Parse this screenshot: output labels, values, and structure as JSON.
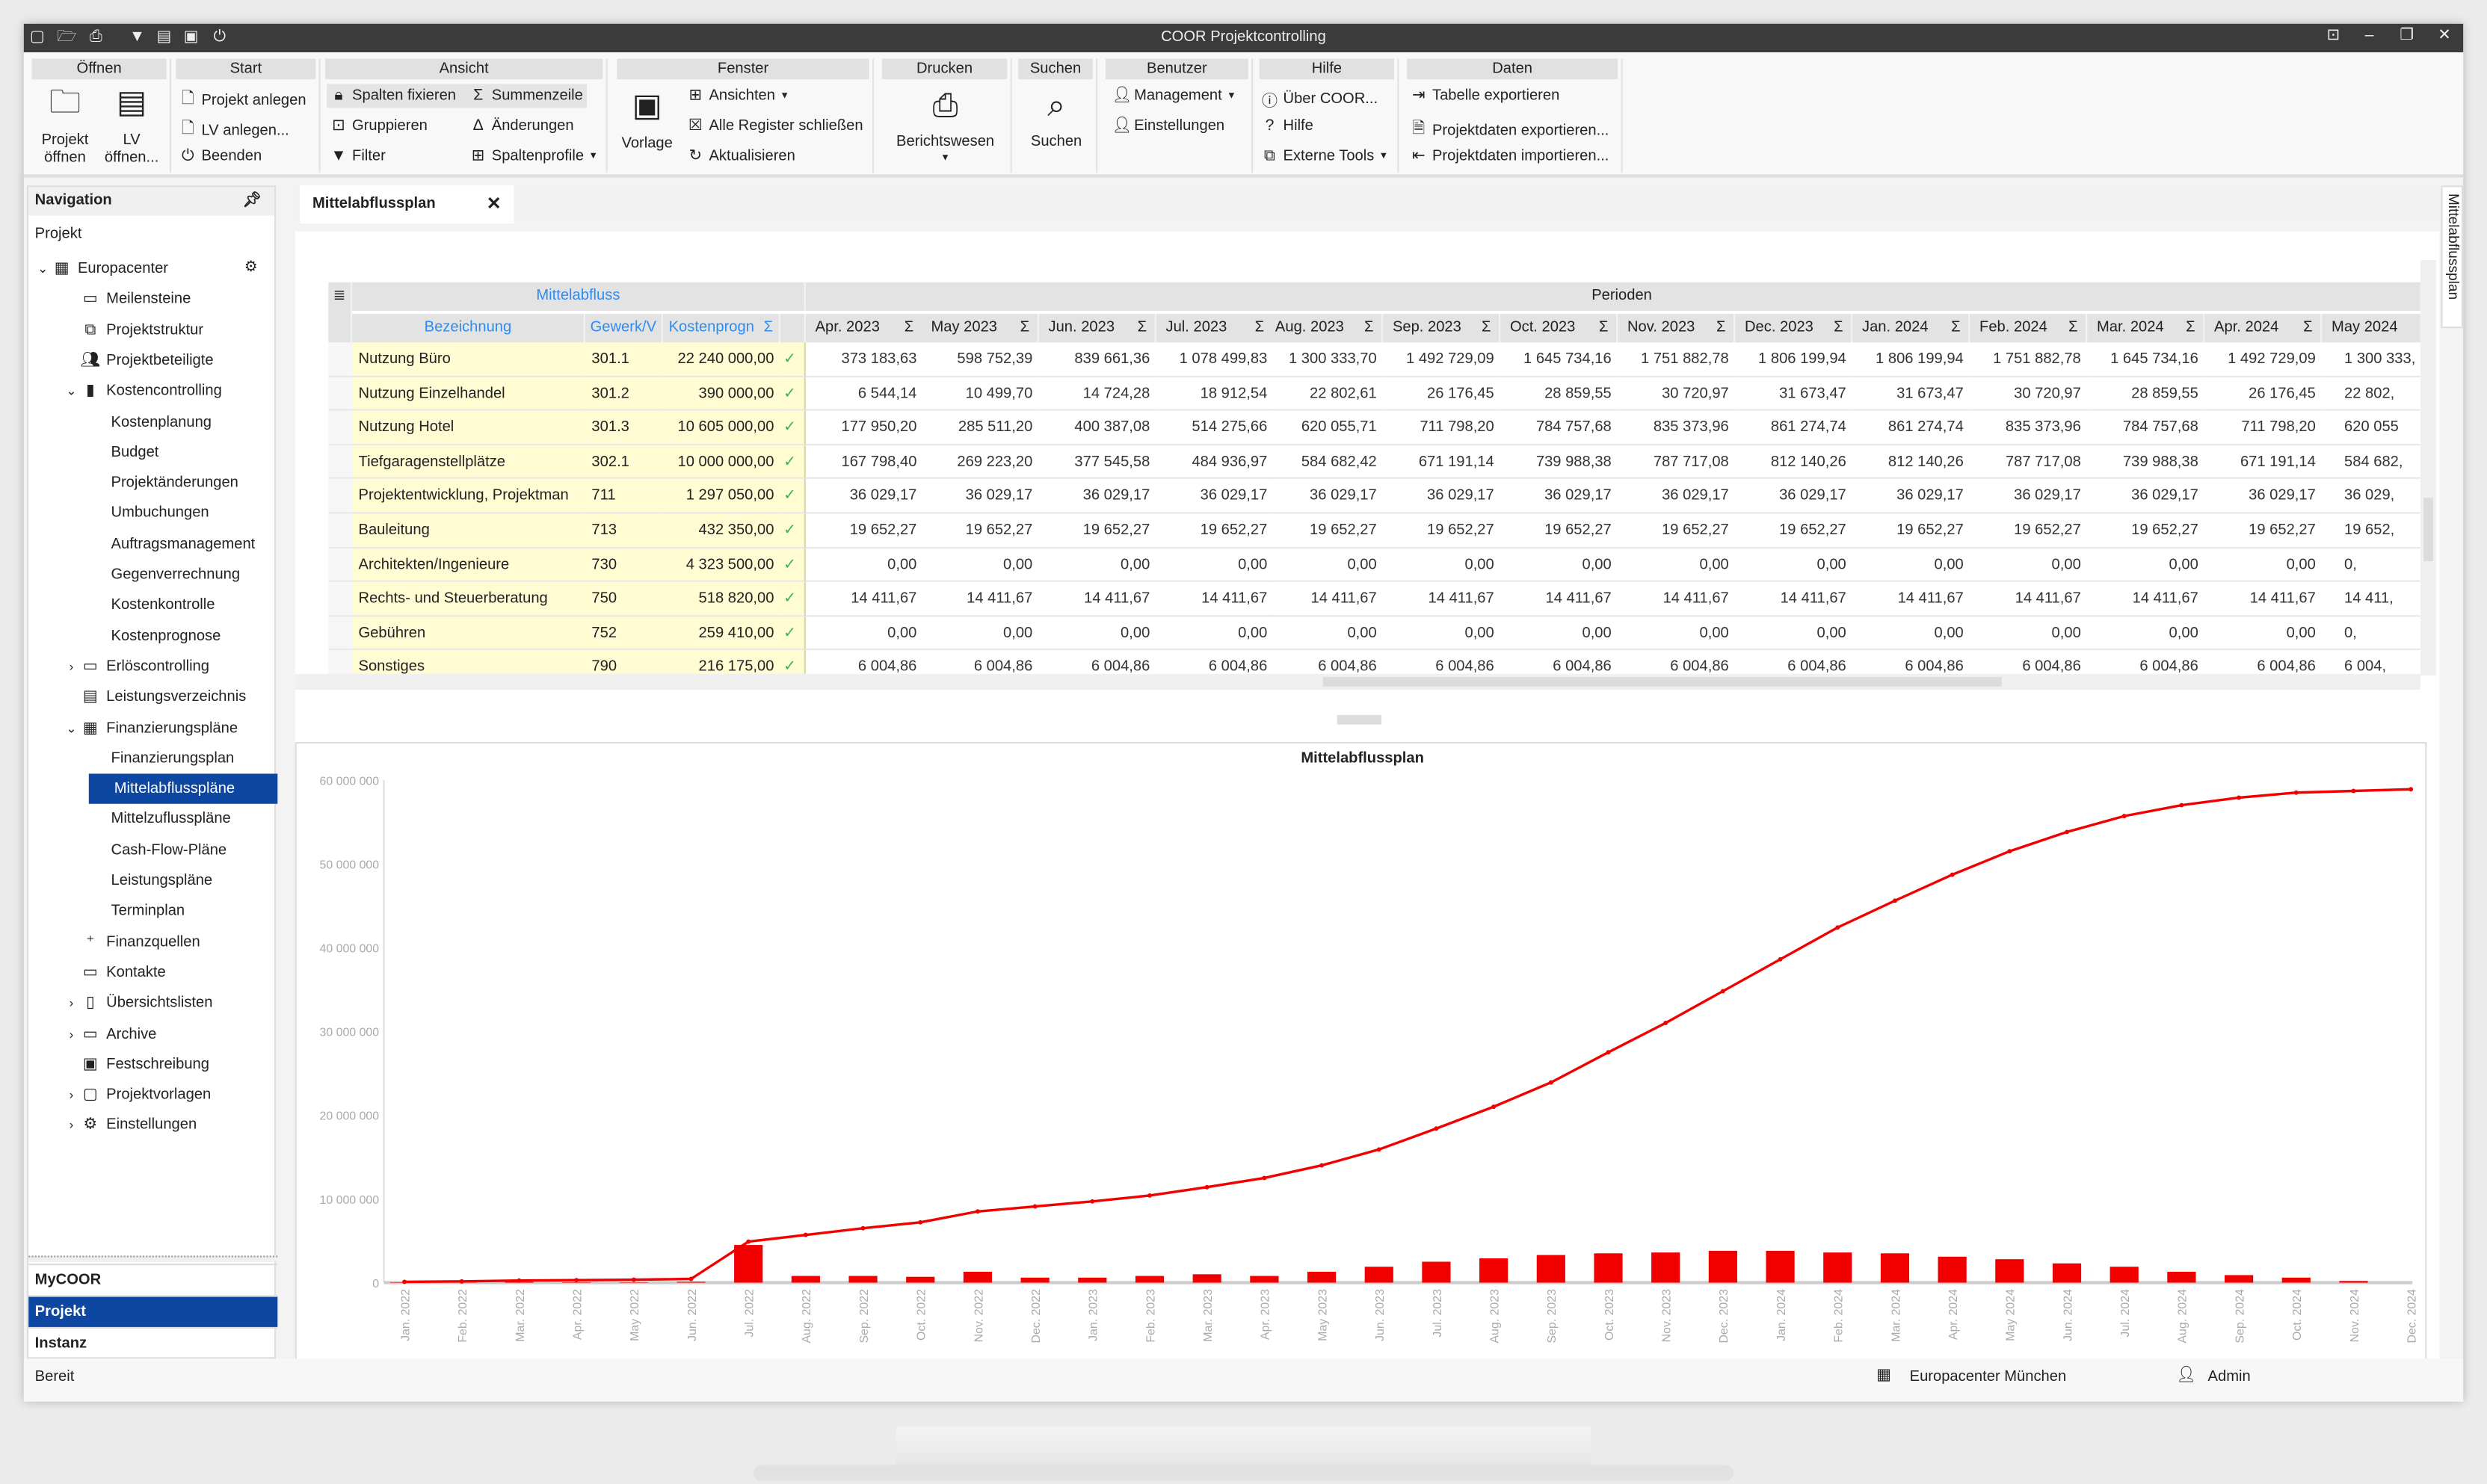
{
  "window": {
    "title": "COOR Projektcontrolling",
    "accent": "#0d47a1",
    "chart_color": "#f20000"
  },
  "quick_access": [
    "window-icon",
    "folder-open-icon",
    "print-icon",
    "filter-icon",
    "list-icon",
    "card-icon",
    "power-icon"
  ],
  "window_controls": [
    "restore-icon",
    "minimize-icon",
    "maximize-icon",
    "close-icon"
  ],
  "ribbon": {
    "oeffnen": {
      "title": "Öffnen",
      "projekt": "Projekt\nöffnen",
      "lv": "LV\nöffnen..."
    },
    "start": {
      "title": "Start",
      "projekt_anlegen": "Projekt anlegen",
      "lv_anlegen": "LV anlegen...",
      "beenden": "Beenden"
    },
    "ansicht": {
      "title": "Ansicht",
      "spalten_fixieren": "Spalten fixieren",
      "summenzeile": "Summenzeile",
      "gruppieren": "Gruppieren",
      "aenderungen": "Änderungen",
      "filter": "Filter",
      "spaltenprofile": "Spaltenprofile"
    },
    "fenster": {
      "title": "Fenster",
      "vorlage": "Vorlage",
      "ansichten": "Ansichten",
      "alle_register": "Alle Register schließen",
      "aktualisieren": "Aktualisieren"
    },
    "drucken": {
      "title": "Drucken",
      "berichtswesen": "Berichtswesen"
    },
    "suchen": {
      "title": "Suchen",
      "suchen": "Suchen"
    },
    "benutzer": {
      "title": "Benutzer",
      "management": "Management",
      "einstellungen": "Einstellungen"
    },
    "hilfe": {
      "title": "Hilfe",
      "ueber": "Über COOR...",
      "hilfe": "Hilfe",
      "externe_tools": "Externe Tools"
    },
    "daten": {
      "title": "Daten",
      "tabelle_exportieren": "Tabelle exportieren",
      "projektdaten_exportieren": "Projektdaten exportieren...",
      "projektdaten_importieren": "Projektdaten importieren..."
    }
  },
  "navigation": {
    "title": "Navigation",
    "section": "Projekt",
    "items": [
      {
        "label": "Europacenter",
        "level": 0,
        "expander": "open",
        "icon": "building-icon"
      },
      {
        "label": "Meilensteine",
        "level": 1,
        "icon": "calendar-icon"
      },
      {
        "label": "Projektstruktur",
        "level": 1,
        "icon": "structure-icon"
      },
      {
        "label": "Projektbeteiligte",
        "level": 1,
        "icon": "people-icon"
      },
      {
        "label": "Kostencontrolling",
        "level": 1,
        "expander": "open",
        "icon": "bar-chart-icon"
      },
      {
        "label": "Kostenplanung",
        "level": 2
      },
      {
        "label": "Budget",
        "level": 2
      },
      {
        "label": "Projektänderungen",
        "level": 2
      },
      {
        "label": "Umbuchungen",
        "level": 2
      },
      {
        "label": "Auftragsmanagement",
        "level": 2
      },
      {
        "label": "Gegenverrechnung",
        "level": 2
      },
      {
        "label": "Kostenkontrolle",
        "level": 2
      },
      {
        "label": "Kostenprognose",
        "level": 2
      },
      {
        "label": "Erlöscontrolling",
        "level": 1,
        "expander": "closed",
        "icon": "money-icon"
      },
      {
        "label": "Leistungsverzeichnis",
        "level": 1,
        "icon": "list-icon"
      },
      {
        "label": "Finanzierungspläne",
        "level": 1,
        "expander": "open",
        "icon": "calendar-grid-icon"
      },
      {
        "label": "Finanzierungsplan",
        "level": 2
      },
      {
        "label": "Mittelabflusspläne",
        "level": 2,
        "selected": true
      },
      {
        "label": "Mittelzuflusspläne",
        "level": 2
      },
      {
        "label": "Cash-Flow-Pläne",
        "level": 2
      },
      {
        "label": "Leistungspläne",
        "level": 2
      },
      {
        "label": "Terminplan",
        "level": 2
      },
      {
        "label": "Finanzquellen",
        "level": 1,
        "icon": "finance-source-icon"
      },
      {
        "label": "Kontakte",
        "level": 1,
        "icon": "contact-card-icon"
      },
      {
        "label": "Übersichtslisten",
        "level": 1,
        "expander": "closed",
        "icon": "document-icon"
      },
      {
        "label": "Archive",
        "level": 1,
        "expander": "closed",
        "icon": "archive-icon"
      },
      {
        "label": "Festschreibung",
        "level": 1,
        "icon": "lock-box-icon"
      },
      {
        "label": "Projektvorlagen",
        "level": 1,
        "expander": "closed",
        "icon": "template-icon"
      },
      {
        "label": "Einstellungen",
        "level": 1,
        "expander": "closed",
        "icon": "gear-icon"
      }
    ],
    "bottom": [
      {
        "label": "MyCOOR"
      },
      {
        "label": "Projekt",
        "selected": true
      },
      {
        "label": "Instanz"
      }
    ]
  },
  "tab": {
    "label": "Mittelabflussplan",
    "side_tab": "Mittelabflussplan"
  },
  "grid": {
    "group_left": "Mittelabfluss",
    "group_right": "Perioden",
    "sigma": "Σ",
    "check": "✓",
    "columns": [
      "Bezeichnung",
      "Gewerk/V",
      "Kostenprogn"
    ],
    "periods": [
      "Apr. 2023",
      "May 2023",
      "Jun. 2023",
      "Jul. 2023",
      "Aug. 2023",
      "Sep. 2023",
      "Oct. 2023",
      "Nov. 2023",
      "Dec. 2023",
      "Jan. 2024",
      "Feb. 2024",
      "Mar. 2024",
      "Apr. 2024",
      "May 2024"
    ],
    "rows": [
      {
        "name": "Nutzung Büro",
        "gewerk": "301.1",
        "prognose": "22 240 000,00",
        "values": [
          "373 183,63",
          "598 752,39",
          "839 661,36",
          "1 078 499,83",
          "1 300 333,70",
          "1 492 729,09",
          "1 645 734,16",
          "1 751 882,78",
          "1 806 199,94",
          "1 806 199,94",
          "1 751 882,78",
          "1 645 734,16",
          "1 492 729,09",
          "1 300 333,"
        ]
      },
      {
        "name": "Nutzung Einzelhandel",
        "gewerk": "301.2",
        "prognose": "390 000,00",
        "values": [
          "6 544,14",
          "10 499,70",
          "14 724,28",
          "18 912,54",
          "22 802,61",
          "26 176,45",
          "28 859,55",
          "30 720,97",
          "31 673,47",
          "31 673,47",
          "30 720,97",
          "28 859,55",
          "26 176,45",
          "22 802,"
        ]
      },
      {
        "name": "Nutzung Hotel",
        "gewerk": "301.3",
        "prognose": "10 605 000,00",
        "values": [
          "177 950,20",
          "285 511,20",
          "400 387,08",
          "514 275,66",
          "620 055,71",
          "711 798,20",
          "784 757,68",
          "835 373,96",
          "861 274,74",
          "861 274,74",
          "835 373,96",
          "784 757,68",
          "711 798,20",
          "620 055"
        ]
      },
      {
        "name": "Tiefgaragenstellplätze",
        "gewerk": "302.1",
        "prognose": "10 000 000,00",
        "values": [
          "167 798,40",
          "269 223,20",
          "377 545,58",
          "484 936,97",
          "584 682,42",
          "671 191,14",
          "739 988,38",
          "787 717,08",
          "812 140,26",
          "812 140,26",
          "787 717,08",
          "739 988,38",
          "671 191,14",
          "584 682,"
        ]
      },
      {
        "name": "Projektentwicklung, Projektman",
        "gewerk": "711",
        "prognose": "1 297 050,00",
        "values": [
          "36 029,17",
          "36 029,17",
          "36 029,17",
          "36 029,17",
          "36 029,17",
          "36 029,17",
          "36 029,17",
          "36 029,17",
          "36 029,17",
          "36 029,17",
          "36 029,17",
          "36 029,17",
          "36 029,17",
          "36 029,"
        ]
      },
      {
        "name": "Bauleitung",
        "gewerk": "713",
        "prognose": "432 350,00",
        "values": [
          "19 652,27",
          "19 652,27",
          "19 652,27",
          "19 652,27",
          "19 652,27",
          "19 652,27",
          "19 652,27",
          "19 652,27",
          "19 652,27",
          "19 652,27",
          "19 652,27",
          "19 652,27",
          "19 652,27",
          "19 652,"
        ]
      },
      {
        "name": "Architekten/Ingenieure",
        "gewerk": "730",
        "prognose": "4 323 500,00",
        "values": [
          "0,00",
          "0,00",
          "0,00",
          "0,00",
          "0,00",
          "0,00",
          "0,00",
          "0,00",
          "0,00",
          "0,00",
          "0,00",
          "0,00",
          "0,00",
          "0,"
        ]
      },
      {
        "name": "Rechts- und Steuerberatung",
        "gewerk": "750",
        "prognose": "518 820,00",
        "values": [
          "14 411,67",
          "14 411,67",
          "14 411,67",
          "14 411,67",
          "14 411,67",
          "14 411,67",
          "14 411,67",
          "14 411,67",
          "14 411,67",
          "14 411,67",
          "14 411,67",
          "14 411,67",
          "14 411,67",
          "14 411,"
        ]
      },
      {
        "name": "Gebühren",
        "gewerk": "752",
        "prognose": "259 410,00",
        "values": [
          "0,00",
          "0,00",
          "0,00",
          "0,00",
          "0,00",
          "0,00",
          "0,00",
          "0,00",
          "0,00",
          "0,00",
          "0,00",
          "0,00",
          "0,00",
          "0,"
        ]
      },
      {
        "name": "Sonstiges",
        "gewerk": "790",
        "prognose": "216 175,00",
        "values": [
          "6 004,86",
          "6 004,86",
          "6 004,86",
          "6 004,86",
          "6 004,86",
          "6 004,86",
          "6 004,86",
          "6 004,86",
          "6 004,86",
          "6 004,86",
          "6 004,86",
          "6 004,86",
          "6 004,86",
          "6 004,"
        ]
      }
    ]
  },
  "chart_data": {
    "type": "bar+line",
    "title": "Mittelabflussplan",
    "ylim": [
      0,
      60000000
    ],
    "yticks": [
      "0",
      "10 000 000",
      "20 000 000",
      "30 000 000",
      "40 000 000",
      "50 000 000",
      "60 000 000"
    ],
    "grid": false,
    "categories": [
      "Jan. 2022",
      "Feb. 2022",
      "Mar. 2022",
      "Apr. 2022",
      "May 2022",
      "Jun. 2022",
      "Jul. 2022",
      "Aug. 2022",
      "Sep. 2022",
      "Oct. 2022",
      "Nov. 2022",
      "Dec. 2022",
      "Jan. 2023",
      "Feb. 2023",
      "Mar. 2023",
      "Apr. 2023",
      "May 2023",
      "Jun. 2023",
      "Jul. 2023",
      "Aug. 2023",
      "Sep. 2023",
      "Oct. 2023",
      "Nov. 2023",
      "Dec. 2023",
      "Jan. 2024",
      "Feb. 2024",
      "Mar. 2024",
      "Apr. 2024",
      "May 2024",
      "Jun. 2024",
      "Jul. 2024",
      "Aug. 2024",
      "Sep. 2024",
      "Oct. 2024",
      "Nov. 2024",
      "Dec. 2024"
    ],
    "series": [
      {
        "type": "bar",
        "values": [
          50000,
          50000,
          100000,
          50000,
          50000,
          100000,
          4500000,
          800000,
          800000,
          700000,
          1300000,
          600000,
          600000,
          800000,
          1000000,
          800000,
          1300000,
          1900000,
          2500000,
          2900000,
          3300000,
          3500000,
          3600000,
          3800000,
          3800000,
          3600000,
          3500000,
          3100000,
          2800000,
          2300000,
          1900000,
          1300000,
          900000,
          600000,
          200000,
          0
        ]
      },
      {
        "type": "line",
        "values": [
          100000,
          150000,
          250000,
          300000,
          350000,
          450000,
          4900000,
          5700000,
          6500000,
          7200000,
          8500000,
          9100000,
          9700000,
          10400000,
          11400000,
          12500000,
          14000000,
          15900000,
          18400000,
          21000000,
          23900000,
          27500000,
          31000000,
          34800000,
          38600000,
          42400000,
          45600000,
          48700000,
          51500000,
          53800000,
          55700000,
          57000000,
          57900000,
          58500000,
          58700000,
          58900000
        ]
      }
    ]
  },
  "status": {
    "left": "Bereit",
    "project": "Europacenter München",
    "user": "Admin"
  }
}
